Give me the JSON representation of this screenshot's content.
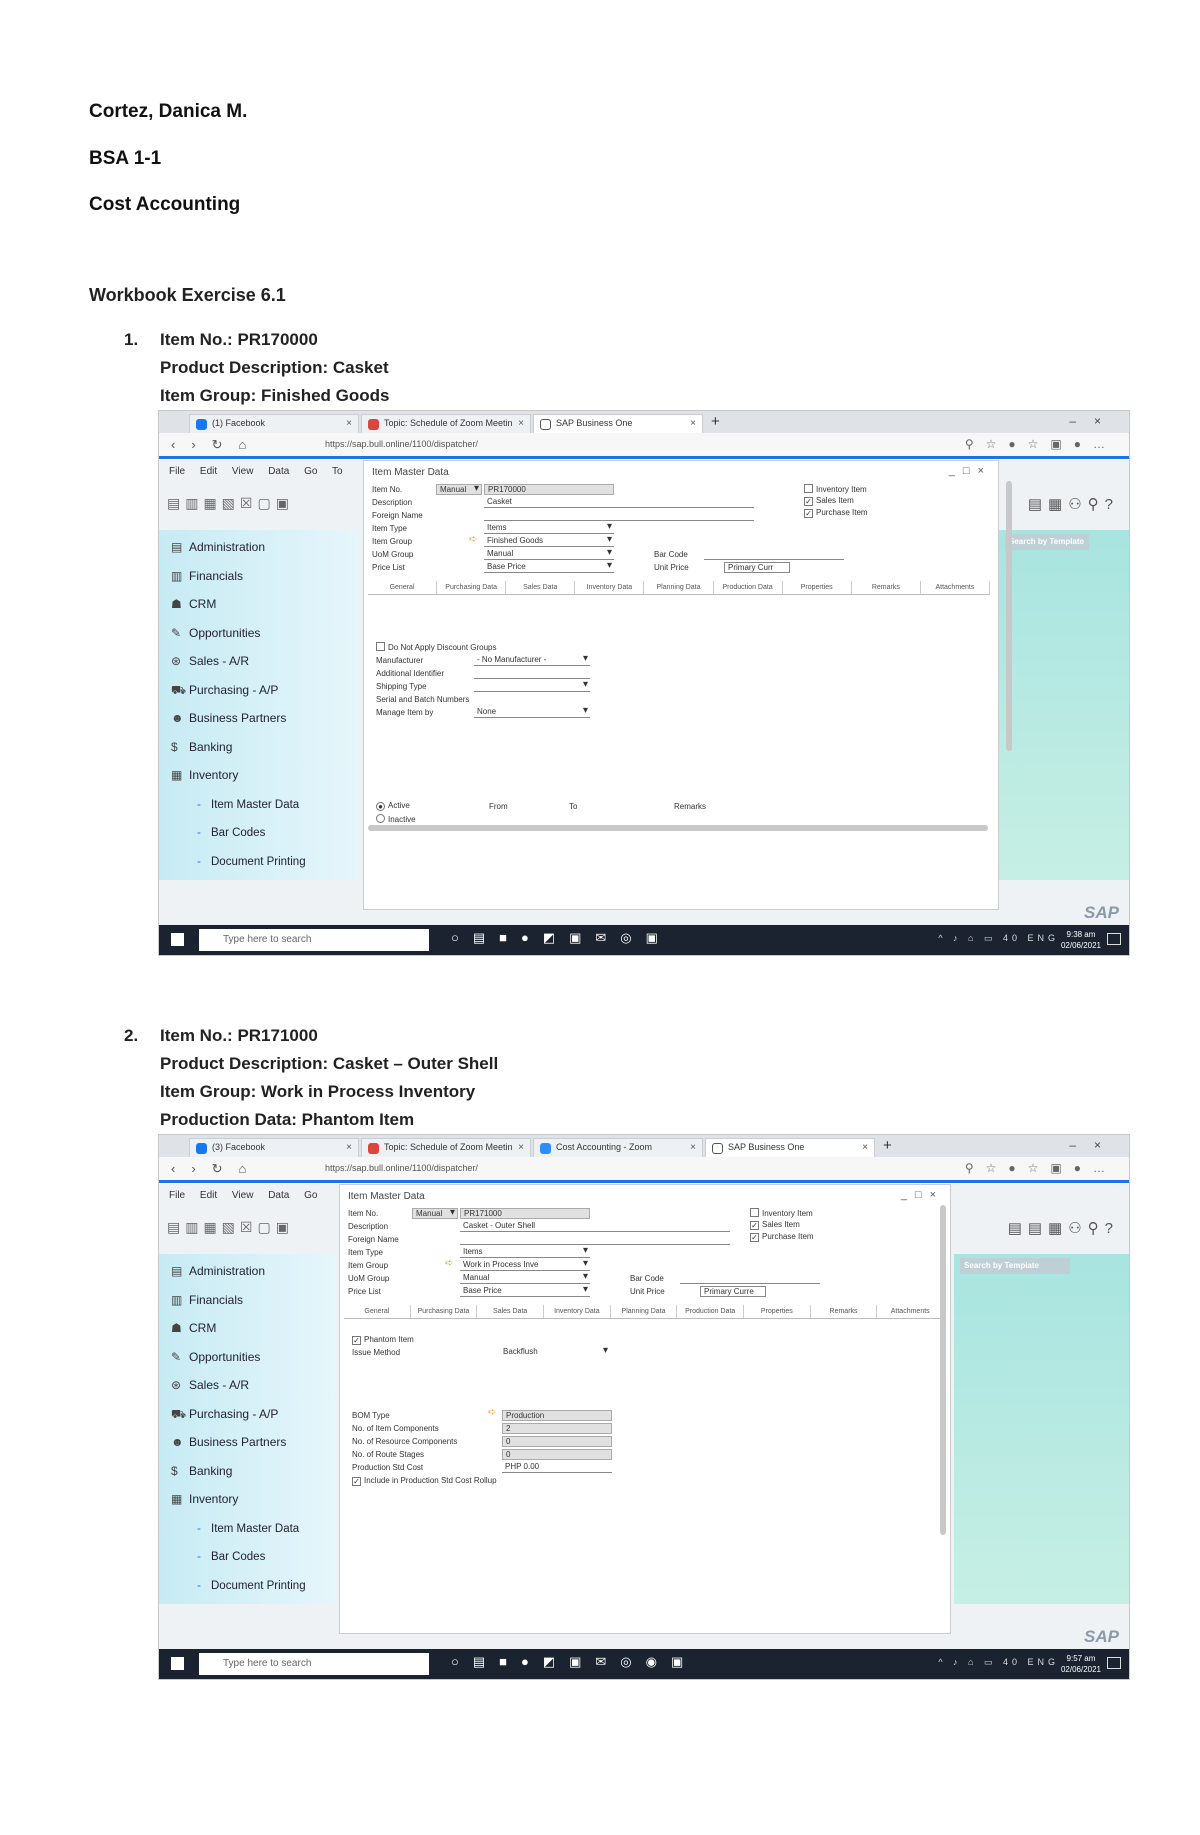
{
  "header": {
    "name": "Cortez, Danica M.",
    "section": "BSA 1-1",
    "course": "Cost Accounting",
    "workbook": "Workbook Exercise 6.1"
  },
  "items": [
    {
      "number": "1.",
      "lines": [
        "Item No.: PR170000",
        "Product Description: Casket",
        "Item Group: Finished Goods"
      ]
    },
    {
      "number": "2.",
      "lines": [
        "Item No.: PR171000",
        "Product Description: Casket – Outer Shell",
        "Item Group: Work in Process Inventory",
        "Production Data: Phantom Item"
      ]
    }
  ],
  "screenshots": [
    {
      "browser_tabs": [
        "(1) Facebook",
        "Topic: Schedule of Zoom Meetin",
        "SAP Business One"
      ],
      "url": "https://sap.bull.online/1100/dispatcher/",
      "menu": [
        "File",
        "Edit",
        "View",
        "Data",
        "Go To"
      ],
      "form_title": "Item Master Data",
      "search_template": "Search by Template",
      "sidebar": [
        {
          "icon": "▤",
          "label": "Administration"
        },
        {
          "icon": "▥",
          "label": "Financials"
        },
        {
          "icon": "☗",
          "label": "CRM"
        },
        {
          "icon": "✎",
          "label": "Opportunities"
        },
        {
          "icon": "⊛",
          "label": "Sales - A/R"
        },
        {
          "icon": "⛟",
          "label": "Purchasing - A/P"
        },
        {
          "icon": "☻",
          "label": "Business Partners"
        },
        {
          "icon": "$",
          "label": "Banking"
        },
        {
          "icon": "▦",
          "label": "Inventory"
        }
      ],
      "sidebar_sub": [
        "Item Master Data",
        "Bar Codes",
        "Document Printing"
      ],
      "fields": {
        "item_no_label": "Item No.",
        "item_no_mode": "Manual",
        "item_no": "PR170000",
        "description_label": "Description",
        "description": "Casket",
        "foreign_label": "Foreign Name",
        "item_type_label": "Item Type",
        "item_type": "Items",
        "item_group_label": "Item Group",
        "item_group": "Finished Goods",
        "uom_label": "UoM Group",
        "uom": "Manual",
        "price_list_label": "Price List",
        "price_list": "Base Price",
        "bar_code_label": "Bar Code",
        "unit_price_label": "Unit Price",
        "unit_price": "Primary Curr"
      },
      "checkboxes": [
        "Inventory Item",
        "Sales Item",
        "Purchase Item"
      ],
      "tabs": [
        "General",
        "Purchasing Data",
        "Sales Data",
        "Inventory Data",
        "Planning Data",
        "Production Data",
        "Properties",
        "Remarks",
        "Attachments"
      ],
      "general": {
        "discount": "Do Not Apply Discount Groups",
        "manufacturer_label": "Manufacturer",
        "manufacturer": "- No Manufacturer -",
        "additional_label": "Additional Identifier",
        "shipping_label": "Shipping Type",
        "serial_label": "Serial and Batch Numbers",
        "manage_label": "Manage Item by",
        "manage": "None",
        "active": "Active",
        "inactive": "Inactive",
        "from": "From",
        "to": "To",
        "remarks": "Remarks"
      },
      "status": "SAP",
      "taskbar": {
        "search": "Type here to search",
        "time": "9:38 am",
        "date": "02/06/2021",
        "tray": "^ ♪ ⌂ ▭ 40 ENG"
      }
    },
    {
      "browser_tabs": [
        "(3) Facebook",
        "Topic: Schedule of Zoom Meetin",
        "Cost Accounting - Zoom",
        "SAP Business One"
      ],
      "url": "https://sap.bull.online/1100/dispatcher/",
      "menu": [
        "File",
        "Edit",
        "View",
        "Data",
        "Go"
      ],
      "form_title": "Item Master Data",
      "search_template": "Search by Template",
      "fields": {
        "item_no_label": "Item No.",
        "item_no_mode": "Manual",
        "item_no": "PR171000",
        "description_label": "Description",
        "description": "Casket - Outer Shell",
        "foreign_label": "Foreign Name",
        "item_type_label": "Item Type",
        "item_type": "Items",
        "item_group_label": "Item Group",
        "item_group": "Work in Process Inve",
        "uom_label": "UoM Group",
        "uom": "Manual",
        "price_list_label": "Price List",
        "price_list": "Base Price",
        "bar_code_label": "Bar Code",
        "unit_price_label": "Unit Price",
        "unit_price": "Primary Curre"
      },
      "production": {
        "phantom": "Phantom Item",
        "issue_label": "Issue Method",
        "issue": "Backflush",
        "bom_type_label": "BOM Type",
        "bom_type": "Production",
        "components_label": "No. of Item Components",
        "components": "2",
        "resource_label": "No. of Resource Components",
        "resource": "0",
        "route_label": "No. of Route Stages",
        "route": "0",
        "std_cost_label": "Production Std Cost",
        "std_cost": "PHP 0.00",
        "rollup": "Include in Production Std Cost Rollup"
      },
      "taskbar": {
        "search": "Type here to search",
        "time": "9:57 am",
        "date": "02/06/2021",
        "tray": "^ ♪ ⌂ ▭ 40 ENG"
      }
    }
  ]
}
